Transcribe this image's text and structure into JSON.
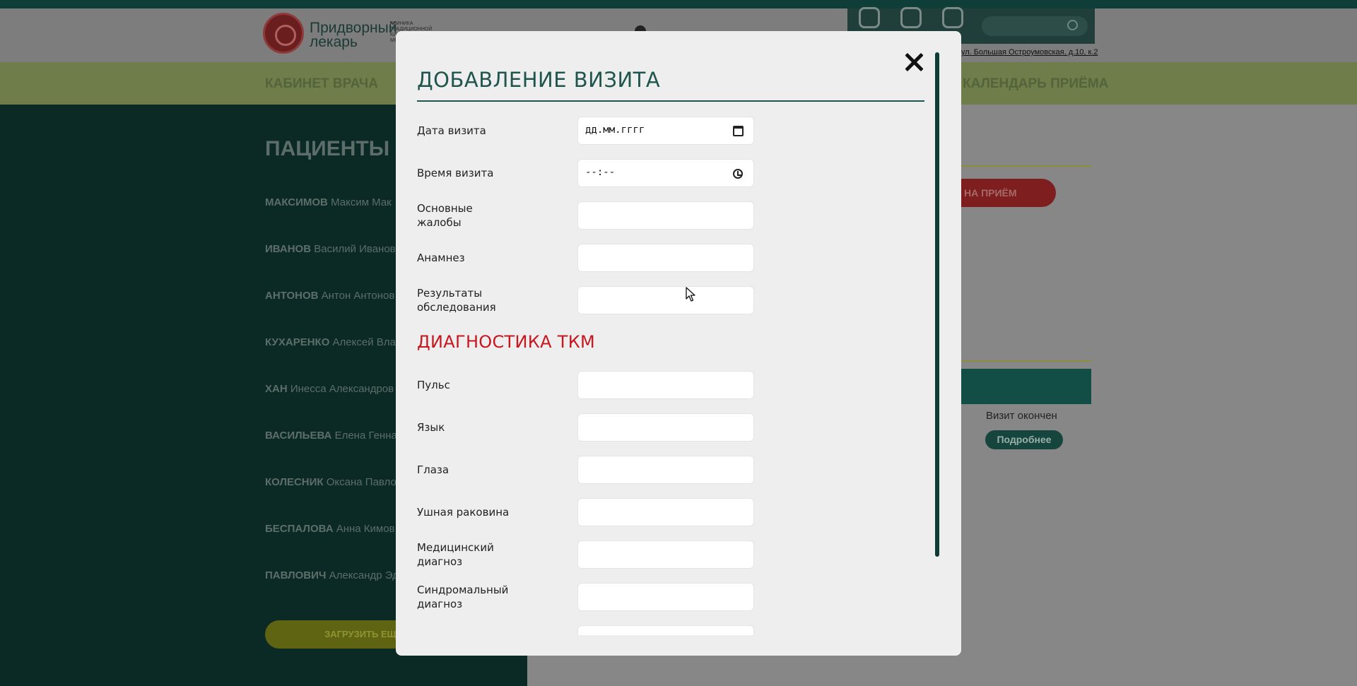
{
  "background": {
    "logo": {
      "line1": "Придворный",
      "line2": "лекарь",
      "sub": "КЛИНИКА ТРАДИЦИОННОЙ КИТАЙСКОЙ МЕДИЦИНЫ"
    },
    "address": "ул. Большая Остроумовская, д.10, к.2",
    "nav_left": "КАБИНЕТ ВРАЧА",
    "nav_right": "КАЛЕНДАРЬ ПРИЁМА",
    "patients_title": "ПАЦИЕНТЫ",
    "patients": [
      {
        "last": "МАКСИМОВ",
        "first": "Максим Мак"
      },
      {
        "last": "ИВАНОВ",
        "first": "Василий Иванов"
      },
      {
        "last": "АНТОНОВ",
        "first": "Антон Антонов"
      },
      {
        "last": "КУХАРЕНКО",
        "first": "Алексей Вла"
      },
      {
        "last": "ХАН",
        "first": "Инесса Александров"
      },
      {
        "last": "ВАСИЛЬЕВА",
        "first": "Елена Генна"
      },
      {
        "last": "КОЛЕСНИК",
        "first": "Оксана Павло"
      },
      {
        "last": "БЕСПАЛОВА",
        "first": "Анна Кимов"
      },
      {
        "last": "ПАВЛОВИЧ",
        "first": "Александр Эд"
      }
    ],
    "upload_button": "ЗАГРУЗИТЬ ЕЩ",
    "appointment_button": "Ь НА ПРИЁМ",
    "visit_status": "Визит окончен",
    "details_button": "Подробнее",
    "colors": {
      "dark_teal": "#0b2a26",
      "accent_red": "#c8161e",
      "title_teal": "#1f554c"
    }
  },
  "modal": {
    "title": "ДОБАВЛЕНИЕ ВИЗИТА",
    "close_icon": "close-icon",
    "fields": [
      {
        "label": "Дата визита",
        "placeholder": "дд.мм.гггг",
        "icon": "calendar-icon"
      },
      {
        "label": "Время визита",
        "placeholder": "--:--",
        "icon": "clock-icon"
      },
      {
        "label_line1": "Основные",
        "label_line2": "жалобы",
        "value": ""
      },
      {
        "label": "Анамнез",
        "value": ""
      },
      {
        "label_line1": "Результаты",
        "label_line2": "обследования",
        "value": ""
      }
    ],
    "section_title": "ДИАГНОСТИКА ТКМ",
    "tcm_fields": [
      {
        "label": "Пульс",
        "value": ""
      },
      {
        "label": "Язык",
        "value": ""
      },
      {
        "label": "Глаза",
        "value": ""
      },
      {
        "label": "Ушная раковина",
        "value": ""
      },
      {
        "label_line1": "Медицинский",
        "label_line2": "диагноз",
        "value": ""
      },
      {
        "label_line1": "Синдромальный",
        "label_line2": "диагноз",
        "value": ""
      }
    ]
  }
}
